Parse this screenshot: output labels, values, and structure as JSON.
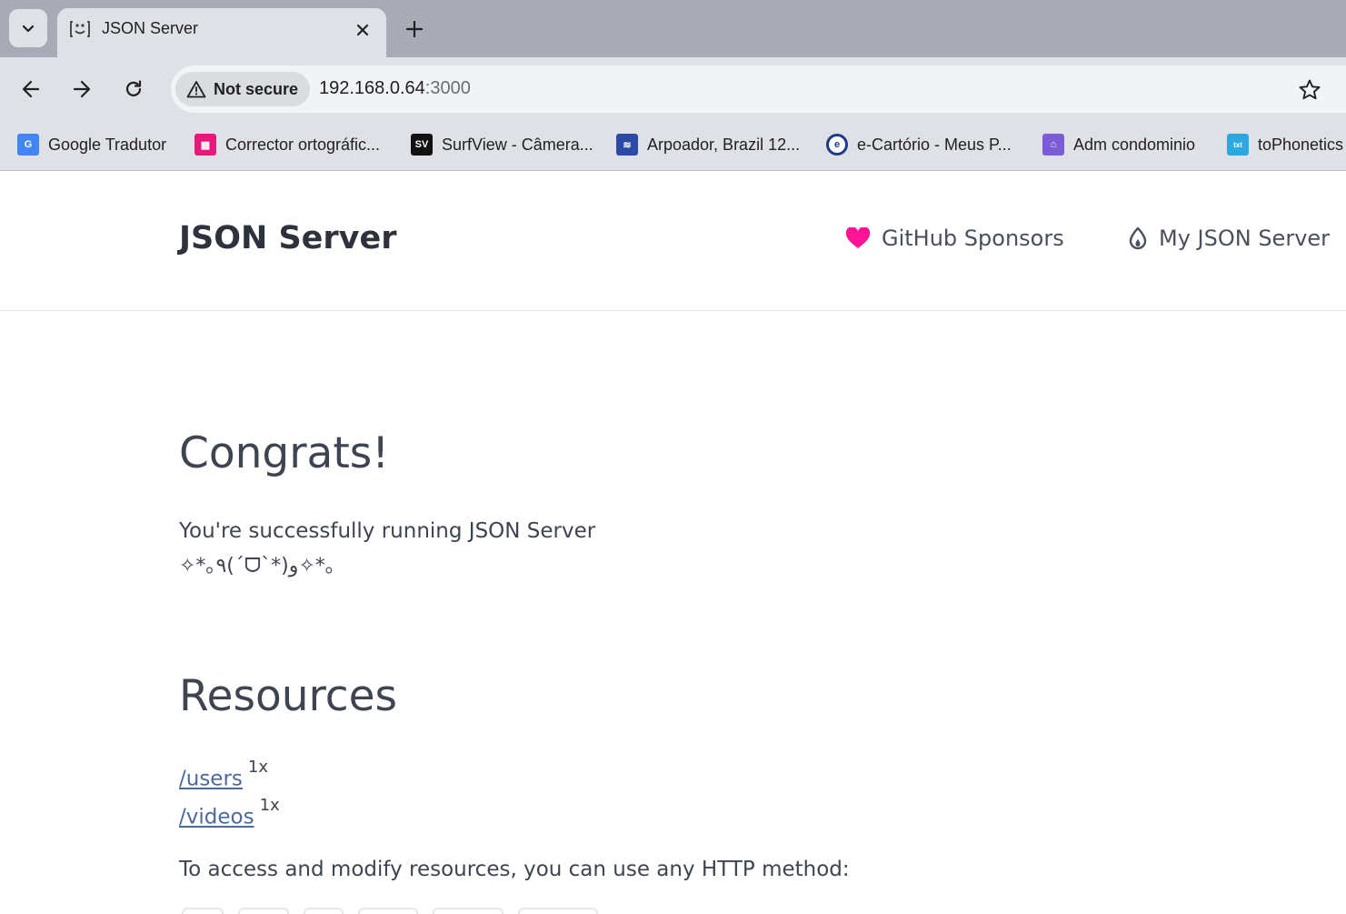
{
  "browser": {
    "tab": {
      "title": "JSON Server"
    },
    "omnibox": {
      "security_label": "Not secure",
      "url_host": "192.168.0.64",
      "url_port": ":3000"
    },
    "bookmarks": [
      {
        "label": "Google Tradutor",
        "icon": "google-translate-icon",
        "color": "#4285f4"
      },
      {
        "label": "Corrector ortográfic...",
        "icon": "corrector-icon",
        "color": "#e8177a"
      },
      {
        "label": "SurfView - Câmera...",
        "icon": "surfview-icon",
        "color": "#111111"
      },
      {
        "label": "Arpoador, Brazil 12...",
        "icon": "wave-icon",
        "color": "#2b4aa6"
      },
      {
        "label": "e-Cartório - Meus P...",
        "icon": "e-cartorio-icon",
        "color": "#1d3a8a"
      },
      {
        "label": "Adm condominio",
        "icon": "condominio-icon",
        "color": "#7b5cd6"
      },
      {
        "label": "toPhonetics",
        "icon": "tophonetics-icon",
        "color": "#29a9e0"
      }
    ]
  },
  "header": {
    "brand": "JSON Server",
    "links": [
      {
        "label": "GitHub Sponsors",
        "icon": "heart-icon",
        "color": "#ff1493"
      },
      {
        "label": "My JSON Server",
        "icon": "flame-icon",
        "color": "#4a4f5c"
      }
    ]
  },
  "main": {
    "congrats_title": "Congrats!",
    "running_text": "You're successfully running JSON Server",
    "kaomoji": "✧*｡٩(ˊᗜˋ*)و✧*｡",
    "resources_title": "Resources",
    "resources": [
      {
        "path": "/users",
        "count": "1x"
      },
      {
        "path": "/videos",
        "count": "1x"
      }
    ],
    "access_text": "To access and modify resources, you can use any HTTP method:"
  }
}
